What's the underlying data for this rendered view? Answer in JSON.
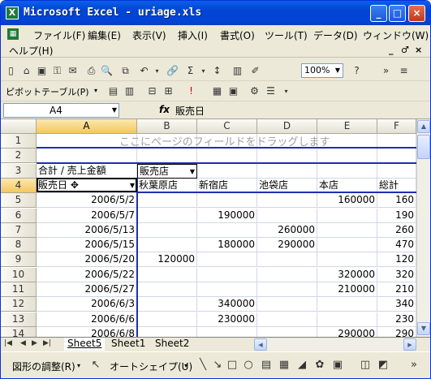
{
  "window": {
    "title": "Microsoft Excel - uriage.xls",
    "icon_letter": "X"
  },
  "menubar": {
    "items": [
      "ファイル(F)",
      "編集(E)",
      "表示(V)",
      "挿入(I)",
      "書式(O)",
      "ツール(T)",
      "データ(D)",
      "ウィンドウ(W)",
      "ヘルプ(H)"
    ],
    "controls": [
      "_",
      "♂",
      "×"
    ]
  },
  "toolbar": {
    "zoom": "100%"
  },
  "pivot_toolbar": {
    "label": "ピボットテーブル(P)"
  },
  "formula_bar": {
    "name_box": "A4",
    "fx": "fx",
    "value": "販売日"
  },
  "columns": [
    "A",
    "B",
    "C",
    "D",
    "E",
    "F"
  ],
  "rows": [
    "1",
    "2",
    "3",
    "4",
    "5",
    "6",
    "7",
    "8",
    "9",
    "10",
    "11",
    "12",
    "13",
    "14"
  ],
  "ghost_text": "ここにページのフィールドをドラッグします",
  "pivot": {
    "data_field": "合計 / 売上金額",
    "col_field": "販売店",
    "row_field": "販売日",
    "col_items": [
      "秋葉原店",
      "新宿店",
      "池袋店",
      "本店",
      "総計"
    ],
    "data_rows": [
      {
        "date": "2006/5/2",
        "values": [
          "",
          "",
          "",
          "160000",
          "160"
        ]
      },
      {
        "date": "2006/5/7",
        "values": [
          "",
          "190000",
          "",
          "",
          "190"
        ]
      },
      {
        "date": "2006/5/13",
        "values": [
          "",
          "",
          "260000",
          "",
          "260"
        ]
      },
      {
        "date": "2006/5/15",
        "values": [
          "",
          "180000",
          "290000",
          "",
          "470"
        ]
      },
      {
        "date": "2006/5/20",
        "values": [
          "120000",
          "",
          "",
          "",
          "120"
        ]
      },
      {
        "date": "2006/5/22",
        "values": [
          "",
          "",
          "",
          "320000",
          "320"
        ]
      },
      {
        "date": "2006/5/27",
        "values": [
          "",
          "",
          "",
          "210000",
          "210"
        ]
      },
      {
        "date": "2006/6/3",
        "values": [
          "",
          "340000",
          "",
          "",
          "340"
        ]
      },
      {
        "date": "2006/6/6",
        "values": [
          "",
          "230000",
          "",
          "",
          "230"
        ]
      },
      {
        "date": "2006/6/8",
        "values": [
          "",
          "",
          "",
          "290000",
          "290"
        ]
      }
    ]
  },
  "sheet_tabs": [
    "Sheet5",
    "Sheet1",
    "Sheet2"
  ],
  "drawbar": {
    "adjust": "図形の調整(R)",
    "autoshape": "オートシェイプ(U)"
  }
}
